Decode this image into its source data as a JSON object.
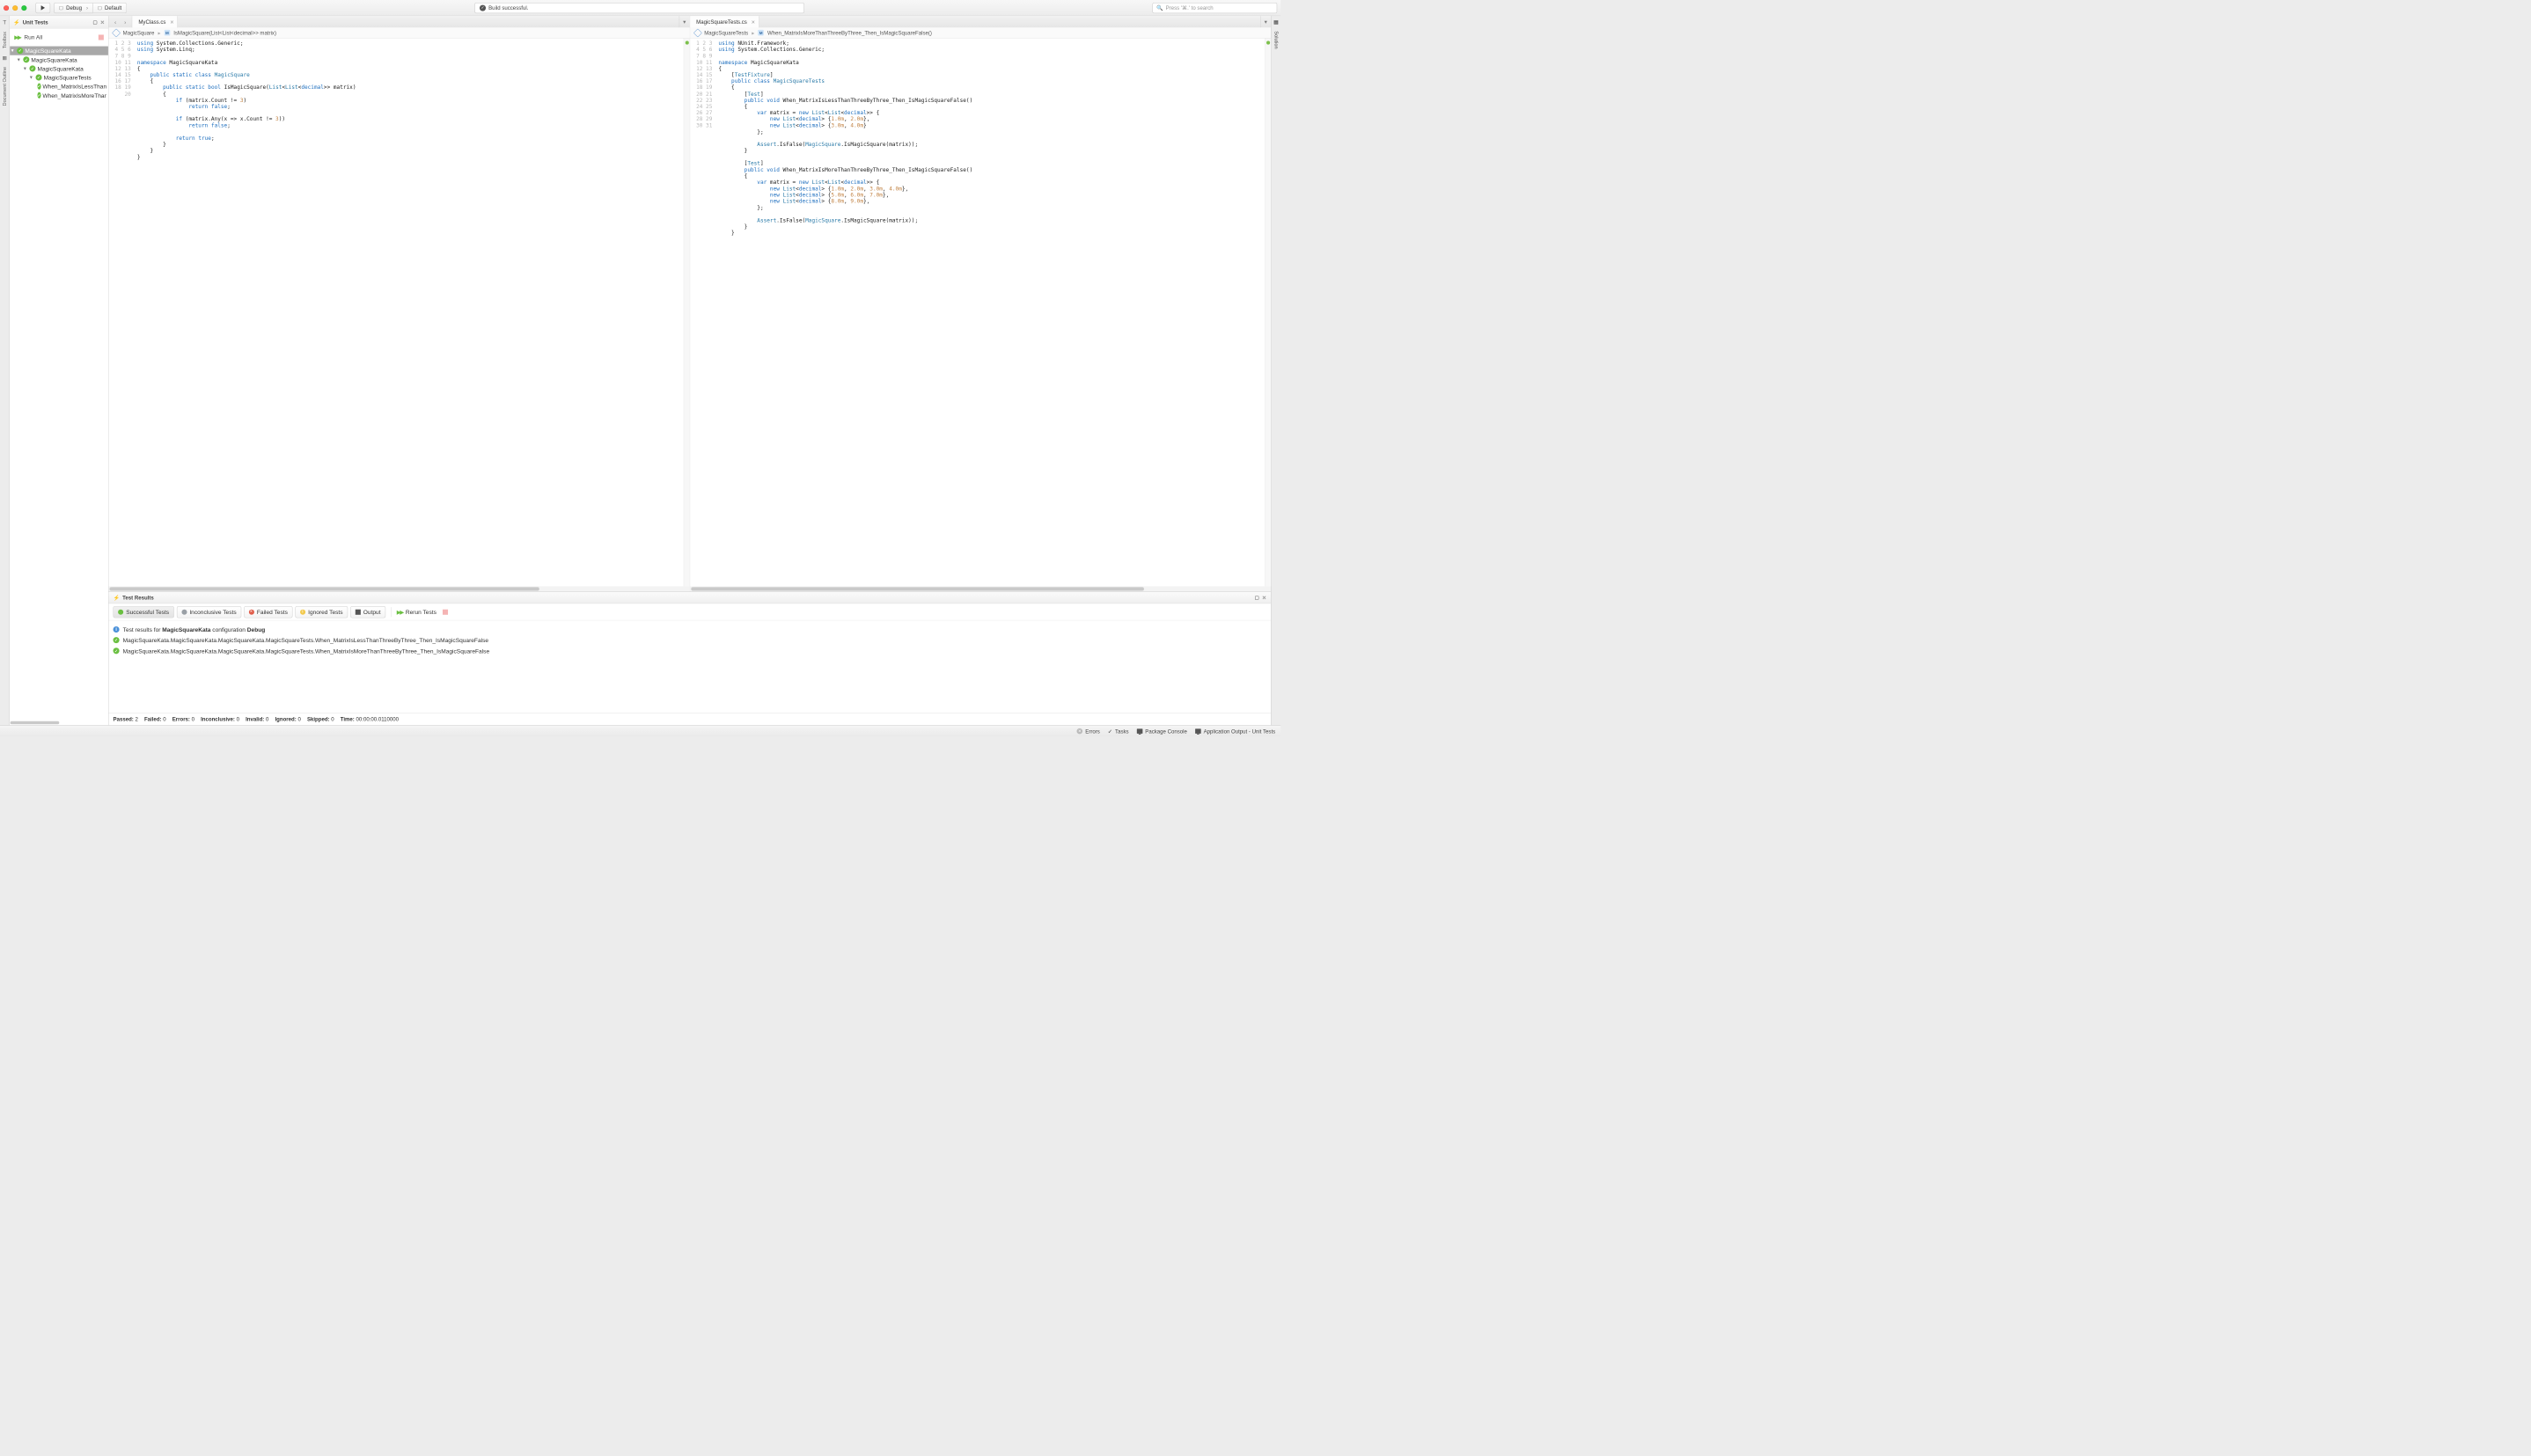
{
  "toolbar": {
    "config": "Debug",
    "target": "Default",
    "build_status": "Build successful.",
    "search_placeholder": "Press '⌘.' to search"
  },
  "siderail_left": {
    "toolbox": "Toolbox",
    "outline": "Document Outline"
  },
  "siderail_right": {
    "solution": "Solution"
  },
  "unit_panel": {
    "title": "Unit Tests",
    "run_all": "Run All",
    "tree": {
      "root": "MagicSquareKata",
      "n1": "MagicSquareKata",
      "n2": "MagicSquareKata",
      "n3": "MagicSquareTests",
      "t1": "When_MatrixIsLessThanThreeByThree_Then_IsMagicSquareFalse",
      "t2": "When_MatrixIsMoreThanThreeByThree_Then_IsMagicSquareFalse"
    }
  },
  "editor_left": {
    "tab": "MyClass.cs",
    "crumb1": "MagicSquare",
    "crumb2": "IsMagicSquare(List<List<decimal>> matrix)",
    "lines": 20
  },
  "editor_right": {
    "tab": "MagicSquareTests.cs",
    "crumb1": "MagicSquareTests",
    "crumb2": "When_MatrixIsMoreThanThreeByThree_Then_IsMagicSquareFalse()",
    "lines": 31
  },
  "results": {
    "title": "Test Results",
    "filters": {
      "success": "Successful Tests",
      "inconclusive": "Inconclusive Tests",
      "failed": "Failed Tests",
      "ignored": "Ignored Tests",
      "output": "Output",
      "rerun": "Rerun Tests"
    },
    "info_prefix": "Test results for ",
    "info_project": "MagicSquareKata",
    "info_mid": " configuration ",
    "info_config": "Debug",
    "r1": "MagicSquareKata.MagicSquareKata.MagicSquareKata.MagicSquareTests.When_MatrixIsLessThanThreeByThree_Then_IsMagicSquareFalse",
    "r2": "MagicSquareKata.MagicSquareKata.MagicSquareKata.MagicSquareTests.When_MatrixIsMoreThanThreeByThree_Then_IsMagicSquareFalse",
    "summary": {
      "passed_l": "Passed:",
      "passed": "2",
      "failed_l": "Failed:",
      "failed": "0",
      "errors_l": "Errors:",
      "errors": "0",
      "inconclusive_l": "Inconclusive:",
      "inconclusive": "0",
      "invalid_l": "Invalid:",
      "invalid": "0",
      "ignored_l": "Ignored:",
      "ignored": "0",
      "skipped_l": "Skipped:",
      "skipped": "0",
      "time_l": "Time:",
      "time": "00:00:00.0110000"
    }
  },
  "statusbar": {
    "errors": "Errors",
    "tasks": "Tasks",
    "pkg": "Package Console",
    "appout": "Application Output - Unit Tests"
  }
}
